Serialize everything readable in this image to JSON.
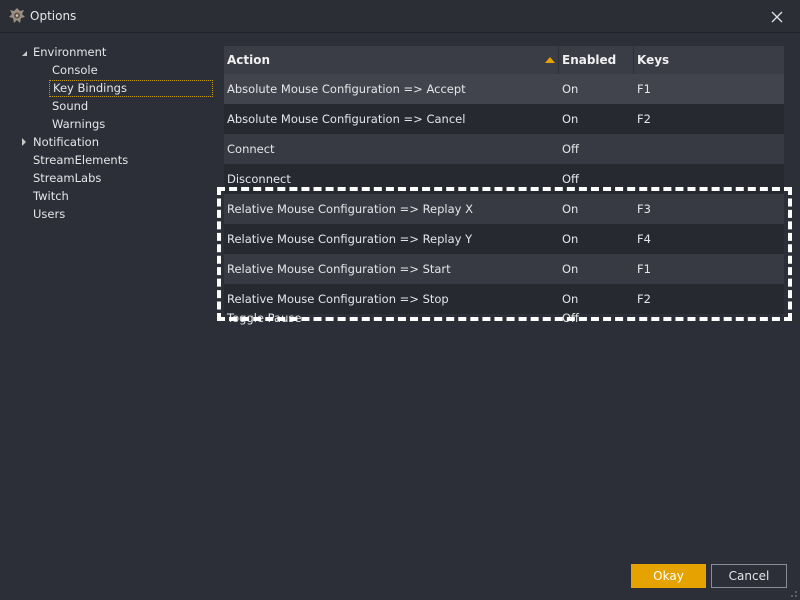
{
  "window": {
    "title": "Options",
    "icons": {
      "app": "game-controller-logo-icon",
      "close": "close-icon",
      "resize": "resize-grip-icon"
    }
  },
  "tree": {
    "items": [
      {
        "label": "Environment",
        "expanded": true
      },
      {
        "label": "Console"
      },
      {
        "label": "Key Bindings",
        "selected": true
      },
      {
        "label": "Sound"
      },
      {
        "label": "Warnings"
      },
      {
        "label": "Notification",
        "expanded": false
      },
      {
        "label": "StreamElements"
      },
      {
        "label": "StreamLabs"
      },
      {
        "label": "Twitch"
      },
      {
        "label": "Users"
      }
    ]
  },
  "table": {
    "columns": [
      "Action",
      "Enabled",
      "Keys"
    ],
    "sort_column": "Action",
    "sort_direction": "ascending",
    "rows": [
      {
        "action": "Absolute Mouse Configuration => Accept",
        "enabled": "On",
        "keys": "F1"
      },
      {
        "action": "Absolute Mouse Configuration => Cancel",
        "enabled": "On",
        "keys": "F2"
      },
      {
        "action": "Connect",
        "enabled": "Off",
        "keys": ""
      },
      {
        "action": "Disconnect",
        "enabled": "Off",
        "keys": ""
      },
      {
        "action": "Relative Mouse Configuration => Replay X",
        "enabled": "On",
        "keys": "F3"
      },
      {
        "action": "Relative Mouse Configuration => Replay Y",
        "enabled": "On",
        "keys": "F4"
      },
      {
        "action": "Relative Mouse Configuration => Start",
        "enabled": "On",
        "keys": "F1"
      },
      {
        "action": "Relative Mouse Configuration => Stop",
        "enabled": "On",
        "keys": "F2"
      },
      {
        "action": "Toggle Pause",
        "enabled": "Off",
        "keys": ""
      }
    ]
  },
  "buttons": {
    "okay": "Okay",
    "cancel": "Cancel"
  },
  "colors": {
    "accent": "#e6a300",
    "background": "#2c2f37",
    "selection_outline": "#ffffff"
  }
}
